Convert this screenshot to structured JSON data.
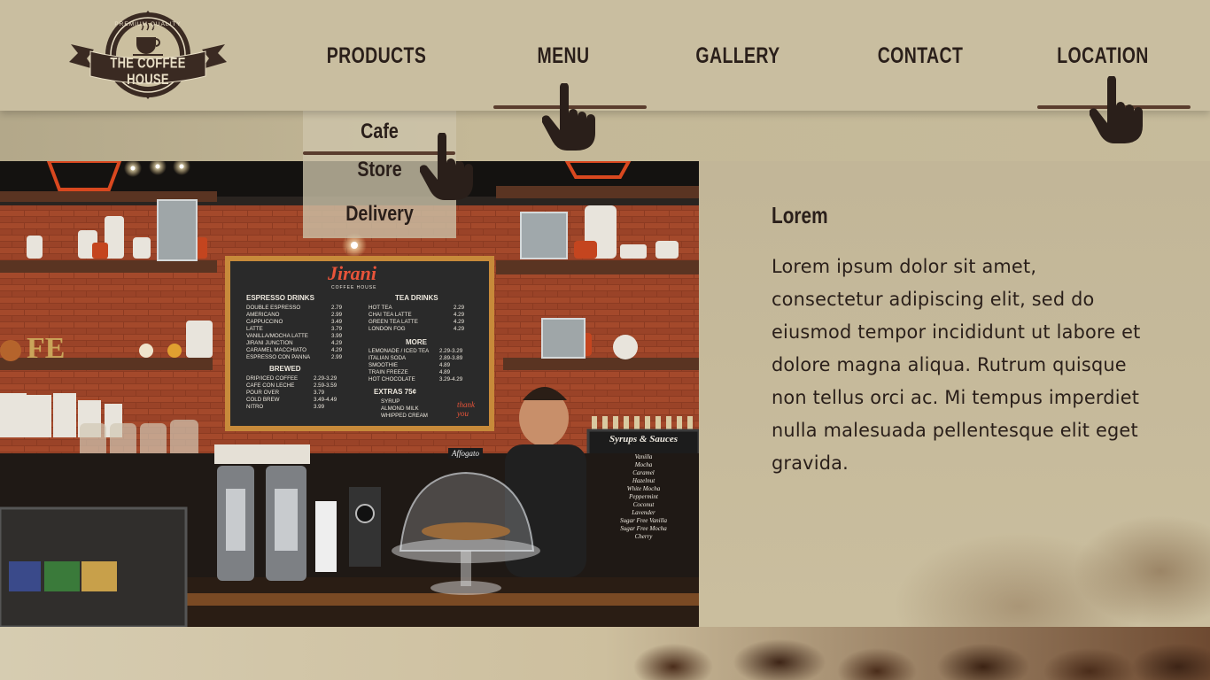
{
  "brand": {
    "name": "THE COFFEE HOUSE",
    "tagline": "PREMIUM QUALITY"
  },
  "nav": {
    "items": [
      {
        "label": "PRODUCTS"
      },
      {
        "label": "MENU"
      },
      {
        "label": "GALLERY"
      },
      {
        "label": "CONTACT"
      },
      {
        "label": "LOCATION"
      }
    ]
  },
  "dropdown": {
    "items": [
      {
        "label": "Cafe"
      },
      {
        "label": "Store"
      },
      {
        "label": "Delivery"
      }
    ]
  },
  "content": {
    "title": "Lorem",
    "body": "Lorem ipsum dolor sit amet, consectetur adipiscing elit, sed do eiusmod tempor incididunt ut labore et dolore magna aliqua. Rutrum quisque non tellus orci ac. Mi tempus imperdiet nulla malesuada pellentesque elit eget gravida."
  },
  "chalkboard": {
    "name": "Jirani",
    "subtitle": "COFFEE HOUSE",
    "espresso_heading": "ESPRESSO DRINKS",
    "espresso_items": [
      "DOUBLE ESPRESSO",
      "AMERICANO",
      "CAPPUCCINO",
      "LATTE",
      "VANILLA/MOCHA LATTE",
      "JIRANI JUNCTION",
      "CARAMEL MACCHIATO",
      "ESPRESSO CON PANNA"
    ],
    "espresso_prices": [
      "2.79",
      "2.99",
      "3.49",
      "3.79",
      "3.99",
      "4.29",
      "4.29",
      "2.99"
    ],
    "tea_heading": "TEA DRINKS",
    "tea_items": [
      "HOT TEA",
      "CHAI TEA LATTE",
      "GREEN TEA LATTE",
      "LONDON FOG"
    ],
    "tea_prices": [
      "2.29",
      "4.29",
      "4.29",
      "4.29"
    ],
    "more_heading": "MORE",
    "more_items": [
      "LEMONADE / ICED TEA",
      "ITALIAN SODA",
      "SMOOTHIE",
      "TRAIN FREEZE",
      "HOT CHOCOLATE"
    ],
    "more_prices": [
      "2.29-3.29",
      "2.89-3.89",
      "4.89",
      "4.89",
      "3.29-4.29"
    ],
    "brewed_heading": "BREWED",
    "brewed_items": [
      "DRIP/ICED COFFEE",
      "CAFE CON LECHE",
      "POUR OVER",
      "COLD BREW",
      "NITRO"
    ],
    "brewed_prices": [
      "2.29-3.29",
      "2.59-3.59",
      "3.79",
      "3.49-4.49",
      "3.99"
    ],
    "extras_heading": "EXTRAS 75¢",
    "extras_items": [
      "SYRUP",
      "ALMOND MILK",
      "WHIPPED CREAM"
    ],
    "thank_you": "thank you",
    "affogato": "Affogato"
  },
  "side_board": {
    "heading": "Syrups & Sauces",
    "items": [
      "Vanilla",
      "Mocha",
      "Caramel",
      "Hazelnut",
      "White Mocha",
      "Peppermint",
      "Coconut",
      "Lavender",
      "Sugar Free Vanilla",
      "Sugar Free Mocha",
      "Cherry"
    ]
  },
  "icons": {
    "pointer": "hand-pointer-icon"
  },
  "colors": {
    "header_bg": "#c9bea0",
    "text": "#2a1f1a",
    "accent": "#5a3d2e"
  }
}
